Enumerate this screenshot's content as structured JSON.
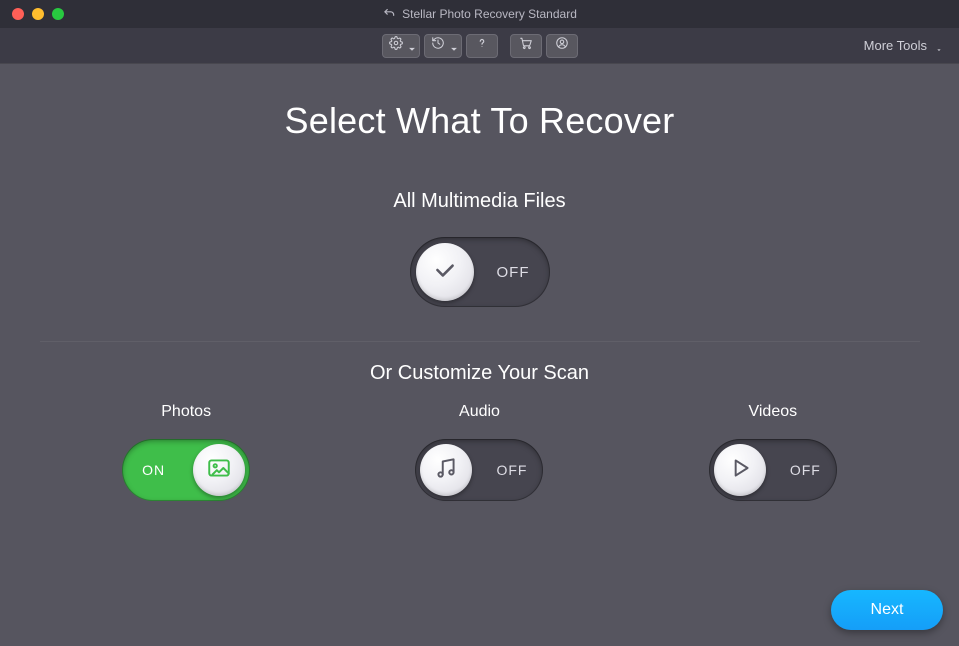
{
  "window": {
    "title": "Stellar Photo Recovery Standard"
  },
  "toolbar": {
    "more_tools_label": "More Tools"
  },
  "page": {
    "title": "Select What To Recover",
    "section_all_label": "All Multimedia Files",
    "subtitle": "Or Customize Your Scan"
  },
  "toggles": {
    "all": {
      "state_label": "OFF",
      "on": false
    },
    "photos": {
      "label": "Photos",
      "state_label": "ON",
      "on": true
    },
    "audio": {
      "label": "Audio",
      "state_label": "OFF",
      "on": false
    },
    "videos": {
      "label": "Videos",
      "state_label": "OFF",
      "on": false
    }
  },
  "buttons": {
    "next": "Next"
  }
}
